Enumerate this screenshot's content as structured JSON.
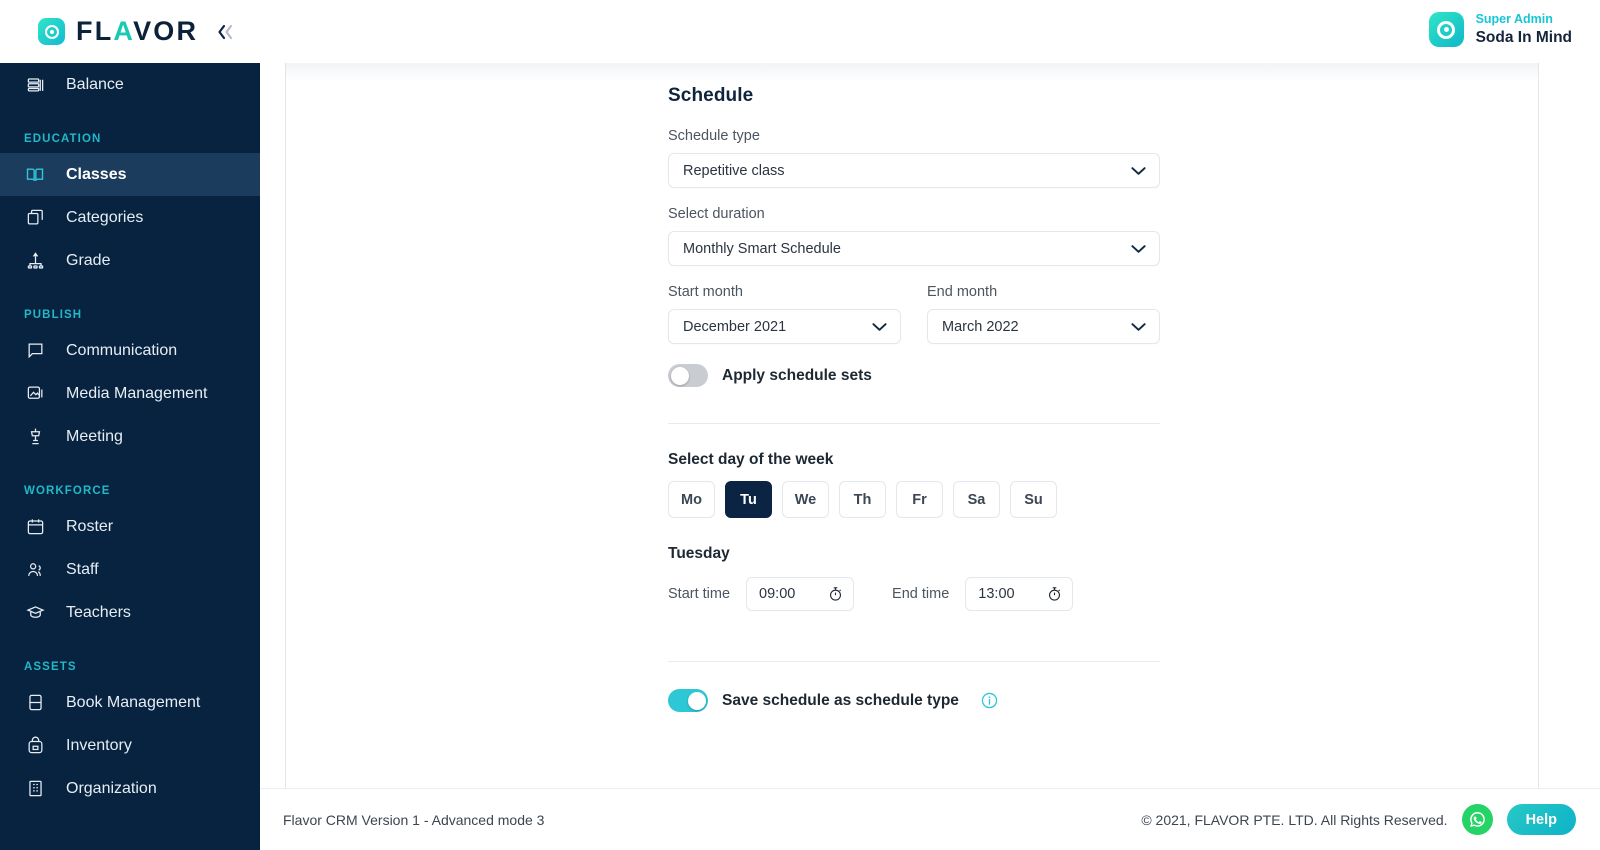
{
  "brand": {
    "name_prefix": "FL",
    "name_accent": "A",
    "name_suffix": "VOR",
    "logo_icon": "target-ring-icon",
    "collapse_icon": "double-chevron-left-icon",
    "accent_color": "#18c9b4",
    "navy_color": "#072340"
  },
  "user": {
    "role": "Super Admin",
    "name": "Soda In Mind",
    "avatar_icon": "target-ring-icon"
  },
  "sidebar": {
    "items": [
      {
        "label": "Balance",
        "icon": "balance-stack-icon",
        "active": false
      },
      {
        "label": "Classes",
        "icon": "open-book-icon",
        "active": true
      },
      {
        "label": "Categories",
        "icon": "stacked-squares-icon",
        "active": false
      },
      {
        "label": "Grade",
        "icon": "hierarchy-icon",
        "active": false
      },
      {
        "label": "Communication",
        "icon": "chat-bubble-icon",
        "active": false
      },
      {
        "label": "Media Management",
        "icon": "image-icon",
        "active": false
      },
      {
        "label": "Meeting",
        "icon": "podium-icon",
        "active": false
      },
      {
        "label": "Roster",
        "icon": "calendar-icon",
        "active": false
      },
      {
        "label": "Staff",
        "icon": "people-icon",
        "active": false
      },
      {
        "label": "Teachers",
        "icon": "graduation-cap-icon",
        "active": false
      },
      {
        "label": "Book Management",
        "icon": "book-icon",
        "active": false
      },
      {
        "label": "Inventory",
        "icon": "backpack-icon",
        "active": false
      },
      {
        "label": "Organization",
        "icon": "building-icon",
        "active": false
      }
    ],
    "sections": {
      "education": "EDUCATION",
      "publish": "PUBLISH",
      "workforce": "WORKFORCE",
      "assets": "ASSETS"
    }
  },
  "schedule": {
    "title": "Schedule",
    "schedule_type": {
      "label": "Schedule type",
      "value": "Repetitive class",
      "chevron_icon": "chevron-down-icon"
    },
    "duration": {
      "label": "Select duration",
      "value": "Monthly Smart Schedule",
      "chevron_icon": "chevron-down-icon"
    },
    "start_month": {
      "label": "Start month",
      "value": "December 2021",
      "chevron_icon": "chevron-down-icon"
    },
    "end_month": {
      "label": "End month",
      "value": "March 2022",
      "chevron_icon": "chevron-down-icon"
    },
    "apply_sets": {
      "label": "Apply schedule sets",
      "on": false
    },
    "day_picker": {
      "label": "Select day of the week",
      "days": [
        "Mo",
        "Tu",
        "We",
        "Th",
        "Fr",
        "Sa",
        "Su"
      ],
      "selected": "Tu"
    },
    "day_detail": {
      "title": "Tuesday",
      "start_label": "Start time",
      "start_value": "09:00",
      "end_label": "End time",
      "end_value": "13:00",
      "clock_icon": "stopwatch-icon"
    },
    "save_as_type": {
      "label": "Save schedule as schedule type",
      "on": true,
      "info_icon": "info-circle-icon"
    }
  },
  "footer": {
    "version": "Flavor CRM Version 1 - Advanced mode 3",
    "copyright": "© 2021, FLAVOR PTE. LTD. All Rights Reserved.",
    "whatsapp_icon": "whatsapp-icon",
    "help_label": "Help"
  }
}
